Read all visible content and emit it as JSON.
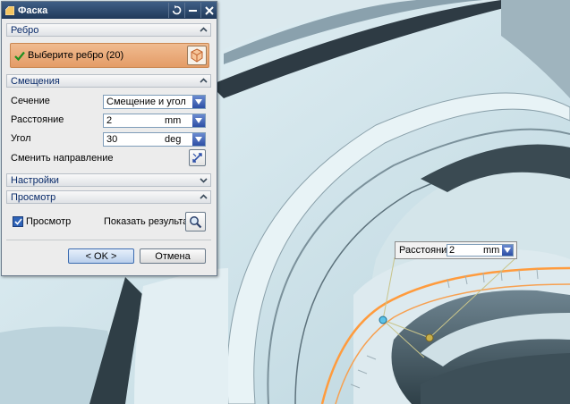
{
  "dialog": {
    "title": "Фаска",
    "sections": {
      "edge": {
        "label": "Ребро",
        "select_text": "Выберите ребро (20)"
      },
      "offsets": {
        "label": "Смещения",
        "section_label": "Сечение",
        "section_value": "Смещение и угол",
        "distance_label": "Расстояние",
        "distance_value": "2",
        "distance_unit": "mm",
        "angle_label": "Угол",
        "angle_value": "30",
        "angle_unit": "deg",
        "flip_label": "Сменить направление"
      },
      "settings": {
        "label": "Настройки"
      },
      "preview": {
        "label": "Просмотр",
        "checkbox_label": "Просмотр",
        "checked": true,
        "show_result_label": "Показать результат"
      }
    },
    "ok_label": "< OK >",
    "cancel_label": "Отмена"
  },
  "canvas_callout": {
    "label": "Расстояние",
    "value": "2",
    "unit": "mm"
  },
  "colors": {
    "title_bar": "#2b4a72",
    "select_bar": "#e8a777",
    "accent": "#ff9b3d",
    "model_surface": "#cfe3ea"
  }
}
